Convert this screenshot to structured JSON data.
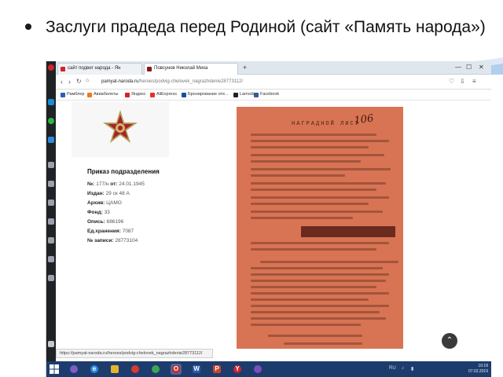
{
  "slide": {
    "title": "Заслуги прадеда перед Родиной (сайт «Память народа»)"
  },
  "browser": {
    "tabs": [
      {
        "label": "сайт подвиг народа - Ян",
        "active": false
      },
      {
        "label": "Повсунов Николай Миха",
        "active": true
      }
    ],
    "address": {
      "domain": "pamyat-naroda.ru",
      "path": "/heroes/podvig-chelovek_nagrazhdenie28773112/"
    },
    "bookmarks": [
      "Рамблер",
      "Авиабилеты",
      "Яндекс",
      "AliExpress",
      "Бронирование оте...",
      "Lamoda",
      "Facebook"
    ],
    "status_link": "https://pamyat-naroda.ru/heroes/podvig-chelovek_nagrazhdenie28773112/",
    "colors": {
      "sidebar_bg": "#1f2326",
      "taskbar_bg": "#1d3c6e",
      "document_bg": "#d87453",
      "opera_red": "#d2232a"
    }
  },
  "order": {
    "title": "Приказ подразделения",
    "rows": [
      {
        "label": "№:",
        "value": "177/н",
        "extra_label": "от:",
        "extra_value": "24.01.1945"
      },
      {
        "label": "Издан:",
        "value": "29 ск 48 А"
      },
      {
        "label": "Архив:",
        "value": "ЦАМО"
      },
      {
        "label": "Фонд:",
        "value": "33"
      },
      {
        "label": "Опись:",
        "value": "686196"
      },
      {
        "label": "Ед.хранения:",
        "value": "7087"
      },
      {
        "label": "№ записи:",
        "value": "28773104"
      }
    ]
  },
  "document": {
    "heading": "НАГРАДНОЙ ЛИСТ",
    "stamp": "106"
  },
  "taskbar": {
    "tray_lang": "RU",
    "time": "10:18",
    "date": "07.02.2019"
  }
}
